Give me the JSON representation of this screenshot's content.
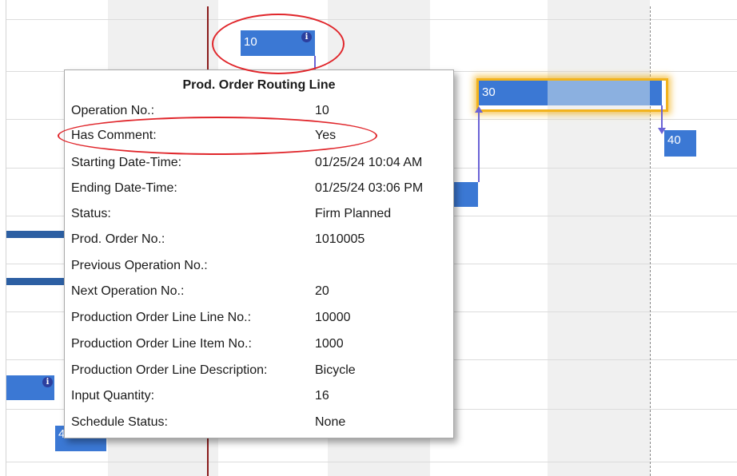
{
  "gantt": {
    "bars": {
      "op10": "10",
      "op30": "30",
      "op40": "40",
      "partial_bottom": "40"
    },
    "info_icon": "i",
    "colors": {
      "bar": "#3b78d4",
      "bar_progress": "#8bb0e0",
      "selection": "#f2b31d",
      "today_line": "#8a1c1c",
      "annotation": "#e0262b"
    }
  },
  "tooltip": {
    "title": "Prod. Order Routing Line",
    "rows": [
      {
        "label": "Operation No.:",
        "value": "10"
      },
      {
        "label": "Has Comment:",
        "value": "Yes"
      },
      {
        "label": "Starting Date-Time:",
        "value": "01/25/24 10:04 AM"
      },
      {
        "label": "Ending Date-Time:",
        "value": "01/25/24 03:06 PM"
      },
      {
        "label": "Status:",
        "value": "Firm Planned"
      },
      {
        "label": "Prod. Order No.:",
        "value": "1010005"
      },
      {
        "label": "Previous Operation No.:",
        "value": ""
      },
      {
        "label": "Next Operation No.:",
        "value": "20"
      },
      {
        "label": "Production Order Line Line No.:",
        "value": "10000"
      },
      {
        "label": "Production Order Line Item No.:",
        "value": "1000"
      },
      {
        "label": "Production Order Line Description:",
        "value": "Bicycle"
      },
      {
        "label": "Input Quantity:",
        "value": "16"
      },
      {
        "label": "Schedule Status:",
        "value": "None"
      }
    ]
  }
}
